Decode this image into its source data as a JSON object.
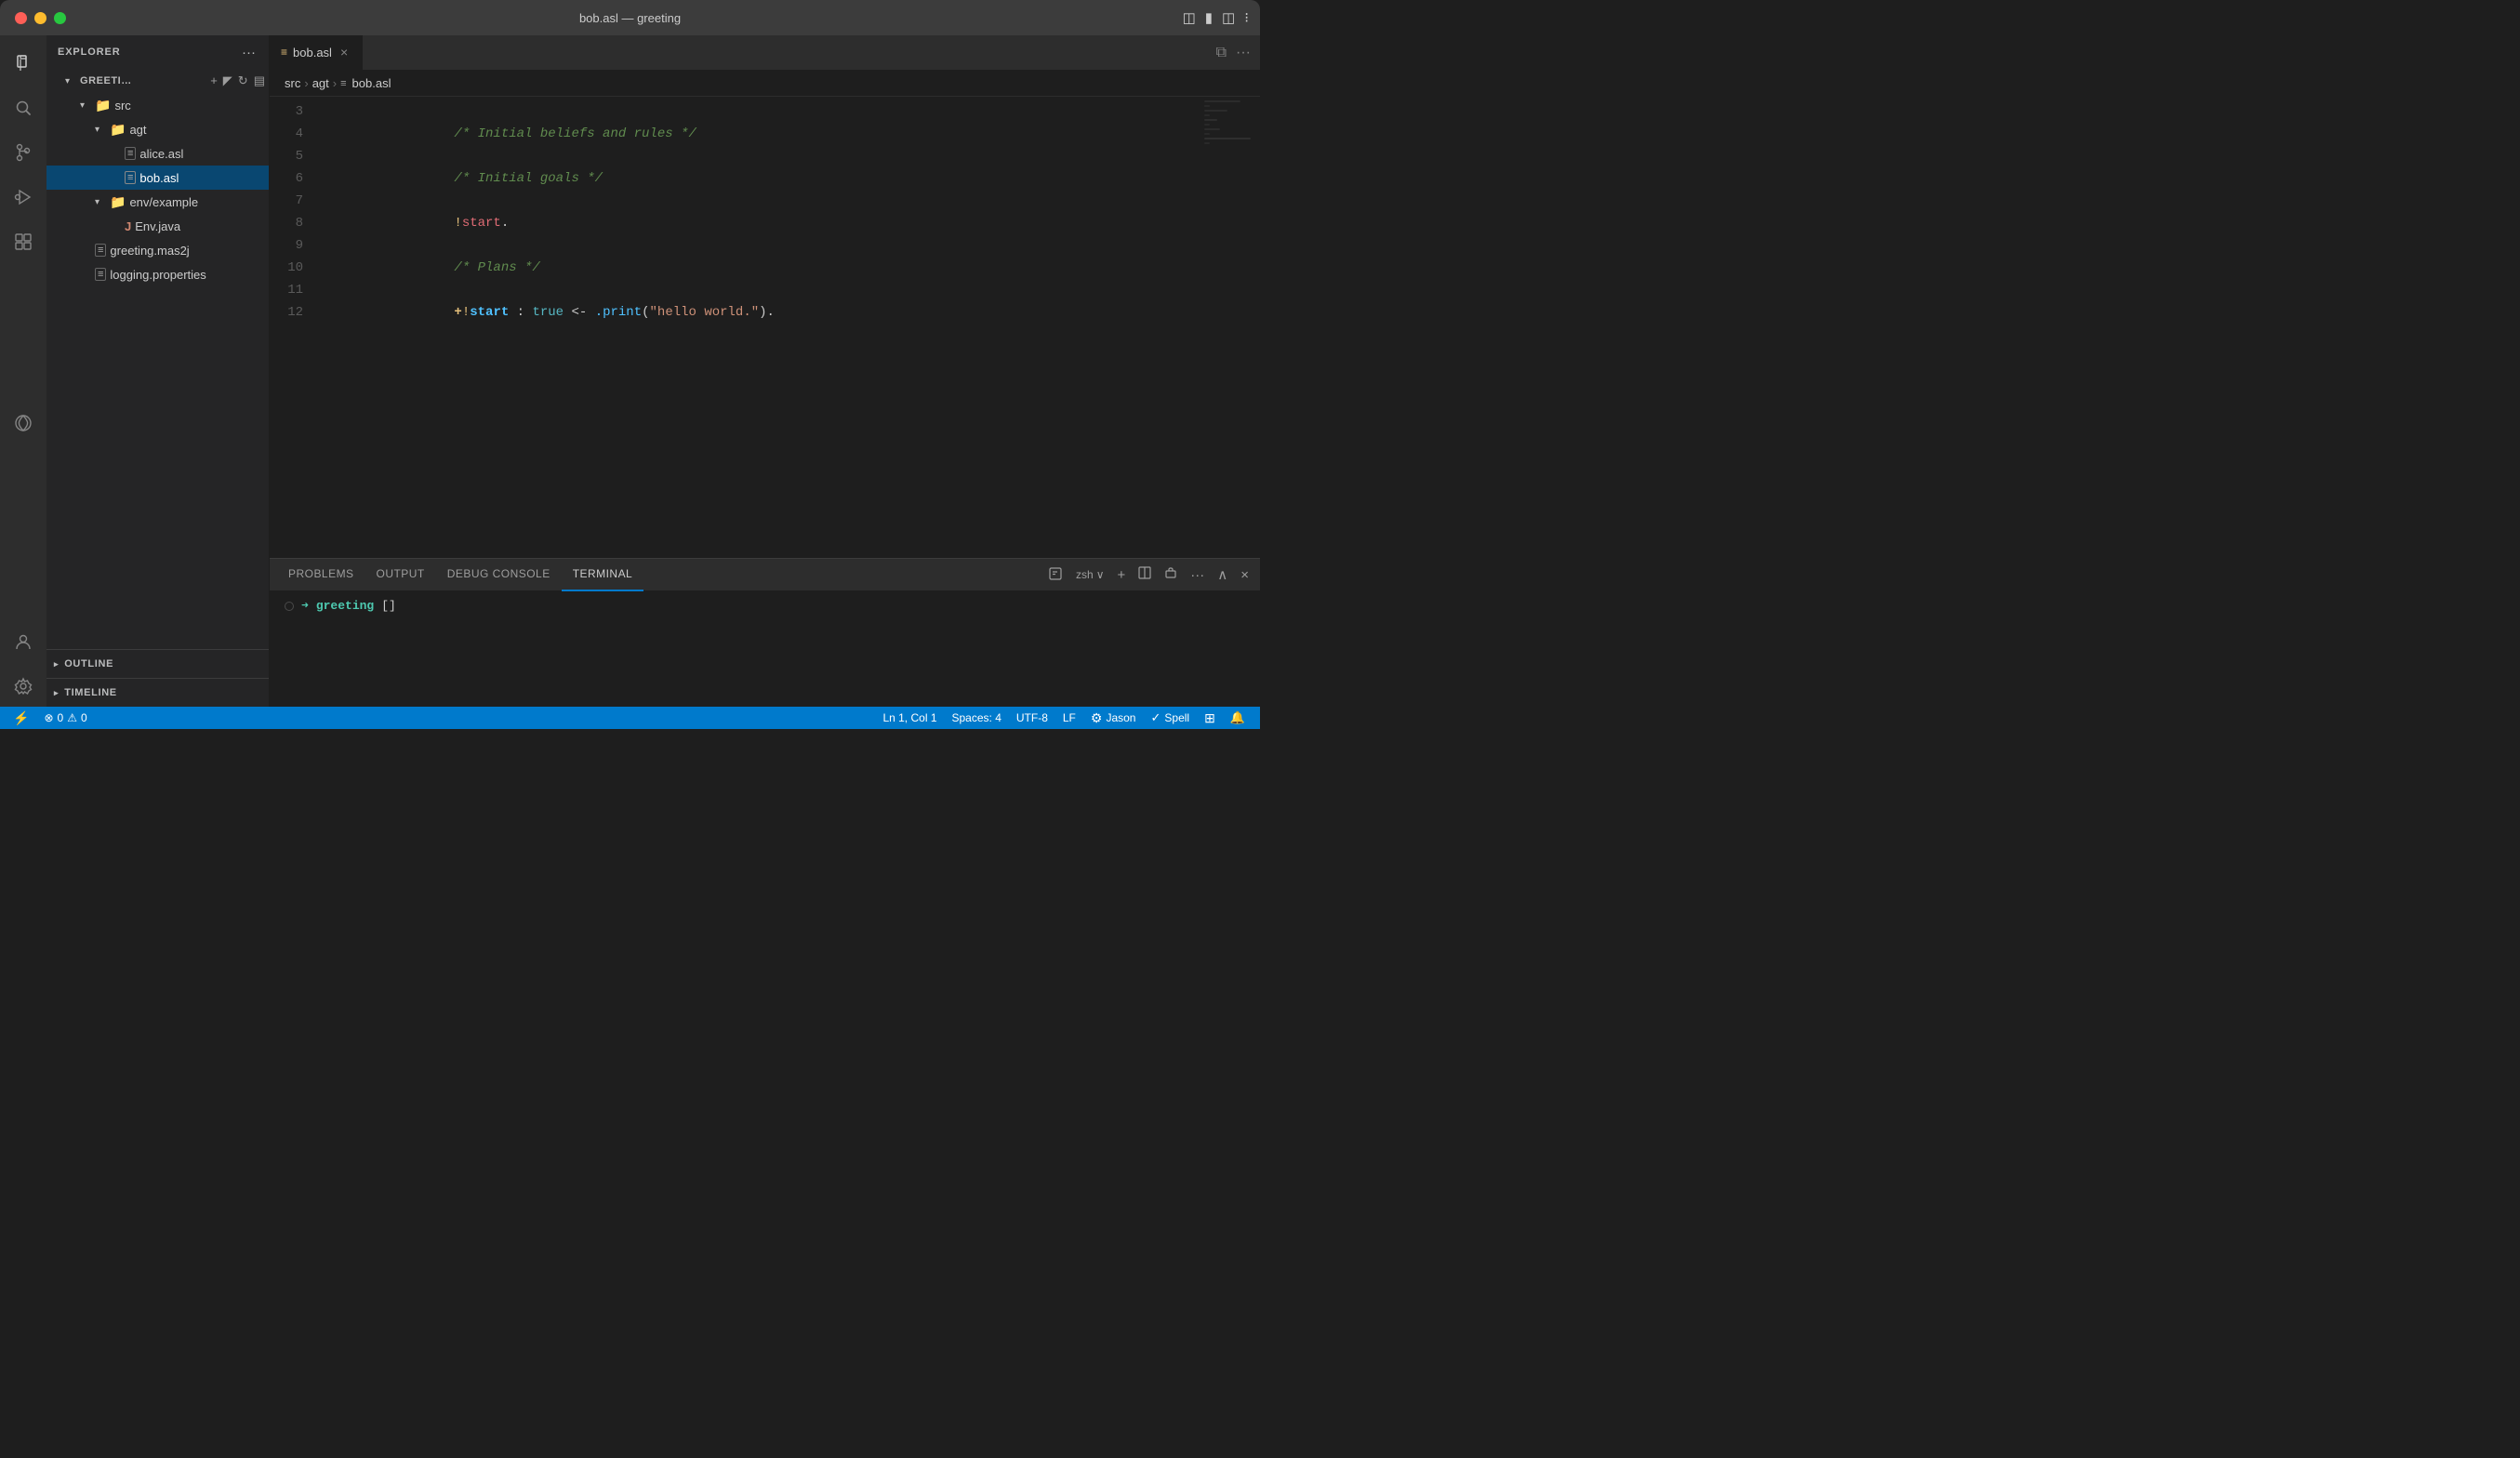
{
  "titlebar": {
    "title": "bob.asl — greeting",
    "buttons": {
      "close": "●",
      "minimize": "●",
      "maximize": "●"
    },
    "right_icons": [
      "layout1",
      "layout2",
      "layout3",
      "layout4"
    ]
  },
  "sidebar": {
    "header": "EXPLORER",
    "more_label": "···",
    "workspace": {
      "name": "GREETI…",
      "folders": [
        {
          "name": "src",
          "expanded": true,
          "children": [
            {
              "name": "agt",
              "expanded": true,
              "children": [
                {
                  "name": "alice.asl",
                  "type": "asl"
                },
                {
                  "name": "bob.asl",
                  "type": "asl",
                  "selected": true
                }
              ]
            },
            {
              "name": "env/example",
              "expanded": true,
              "children": [
                {
                  "name": "Env.java",
                  "type": "java"
                }
              ]
            }
          ]
        },
        {
          "name": "greeting.mas2j",
          "type": "mas2j"
        },
        {
          "name": "logging.properties",
          "type": "properties"
        }
      ]
    },
    "outline_label": "OUTLINE",
    "timeline_label": "TIMELINE"
  },
  "editor": {
    "tab": {
      "name": "bob.asl",
      "modified": true
    },
    "breadcrumb": [
      "src",
      "agt",
      "bob.asl"
    ],
    "lines": [
      {
        "num": "3",
        "content": "comment_start",
        "text": "/* Initial beliefs and rules */"
      },
      {
        "num": "4",
        "content": "empty"
      },
      {
        "num": "5",
        "content": "comment",
        "text": "/* Initial goals */"
      },
      {
        "num": "6",
        "content": "empty"
      },
      {
        "num": "7",
        "content": "start_goal",
        "text": "!start."
      },
      {
        "num": "8",
        "content": "empty"
      },
      {
        "num": "9",
        "content": "comment",
        "text": "/* Plans */"
      },
      {
        "num": "10",
        "content": "empty"
      },
      {
        "num": "11",
        "content": "plan",
        "text": "+!start : true <- .print(\"hello world.\")."
      },
      {
        "num": "12",
        "content": "empty"
      }
    ]
  },
  "terminal": {
    "tabs": [
      "PROBLEMS",
      "OUTPUT",
      "DEBUG CONSOLE",
      "TERMINAL"
    ],
    "active_tab": "TERMINAL",
    "prompt": {
      "dir": "greeting",
      "cursor": "[]"
    },
    "actions": {
      "new_terminal": "+",
      "split": "⊞",
      "kill": "🗑",
      "more": "···",
      "collapse_up": "∧",
      "close": "×",
      "shell": "zsh"
    }
  },
  "statusbar": {
    "left": {
      "branch_icon": "⚡",
      "errors": "0",
      "warnings": "0"
    },
    "right": {
      "position": "Ln 1, Col 1",
      "spaces": "Spaces: 4",
      "encoding": "UTF-8",
      "line_ending": "LF",
      "user": "Jason",
      "spell": "Spell",
      "remote": "⊞",
      "bell": "🔔"
    }
  },
  "activity_bar": {
    "icons": [
      "files",
      "search",
      "source-control",
      "run",
      "extensions",
      "remote"
    ]
  }
}
